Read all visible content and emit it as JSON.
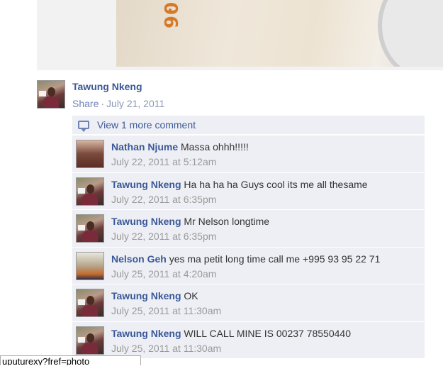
{
  "photo": {
    "visible_text": "90"
  },
  "post": {
    "author": "Tawung Nkeng",
    "share_label": "Share",
    "separator": "·",
    "date": "July 21, 2011"
  },
  "view_more": {
    "label": "View 1 more comment",
    "icon": "comment-bubble-icon"
  },
  "comments": [
    {
      "name": "Nathan Njume",
      "text": "Massa ohhh!!!!!",
      "time": "July 22, 2011 at 5:12am",
      "avatar": "nathan"
    },
    {
      "name": "Tawung Nkeng",
      "text": "Ha ha ha ha Guys cool its me all thesame",
      "time": "July 22, 2011 at 6:35pm",
      "avatar": "tawung"
    },
    {
      "name": "Tawung Nkeng",
      "text": "Mr Nelson longtime",
      "time": "July 22, 2011 at 6:35pm",
      "avatar": "tawung"
    },
    {
      "name": "Nelson Geh",
      "text": "yes ma petit long time call me +995 93 95 22 71",
      "time": "July 25, 2011 at 4:20am",
      "avatar": "nelson"
    },
    {
      "name": "Tawung Nkeng",
      "text": "OK",
      "time": "July 25, 2011 at 11:30am",
      "avatar": "tawung"
    },
    {
      "name": "Tawung Nkeng",
      "text": "WILL CALL MINE IS 00237 78550440",
      "time": "July 25, 2011 at 11:30am",
      "avatar": "tawung"
    }
  ],
  "status_bar": {
    "url": "uputurexy?fref=photo"
  },
  "colors": {
    "link": "#3b5998",
    "comment_bg": "#edeff4",
    "muted": "#999999"
  }
}
